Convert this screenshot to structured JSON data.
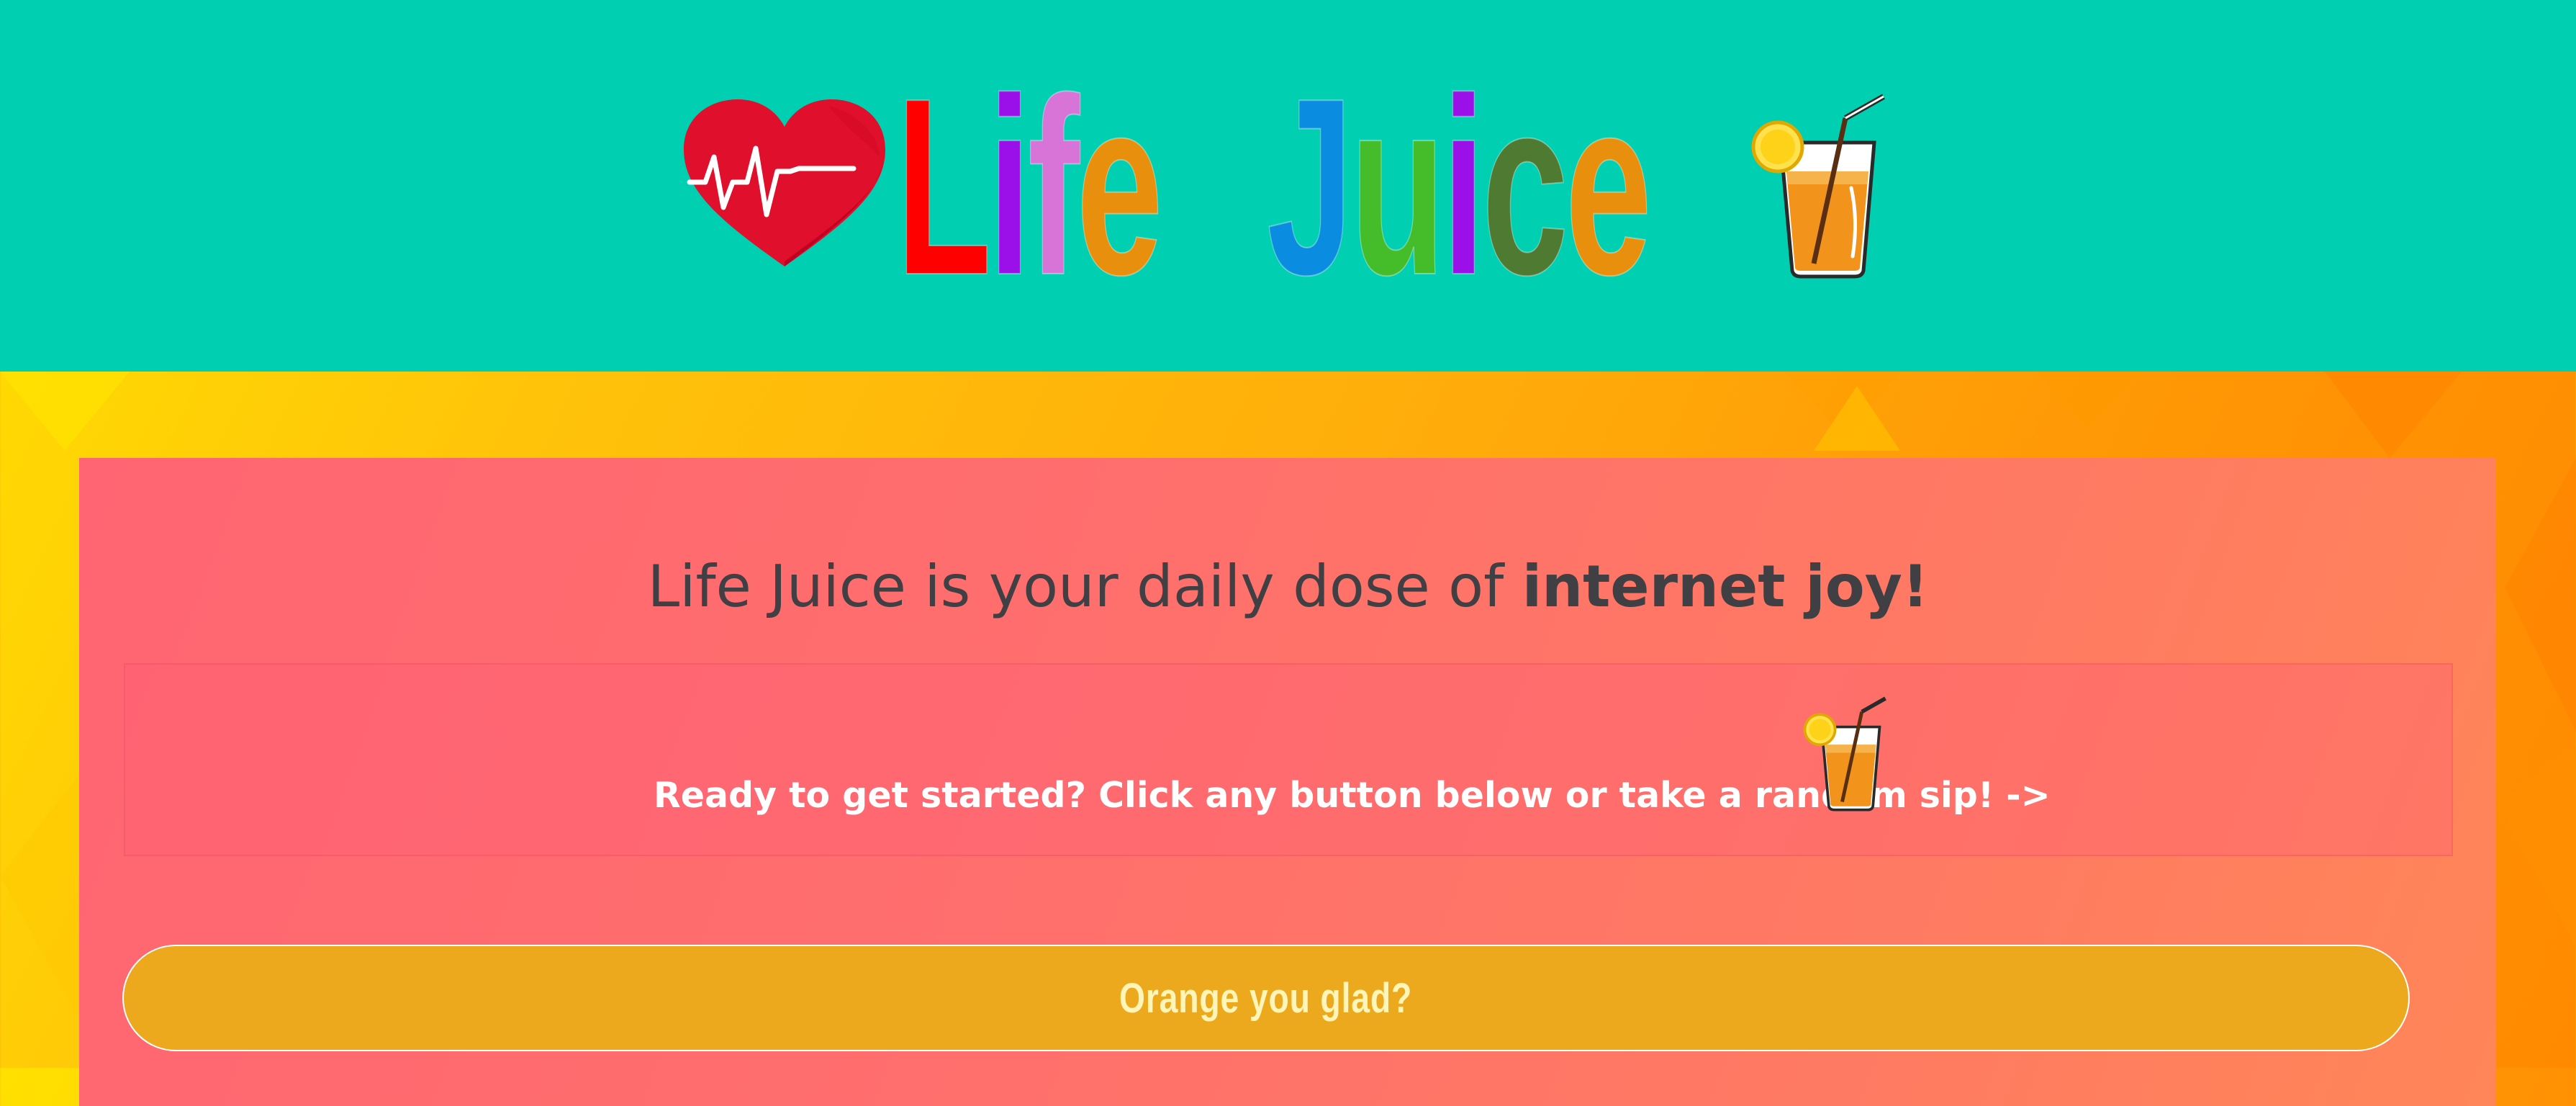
{
  "header": {
    "logo_first_word": [
      "L",
      "i",
      "f",
      "e"
    ],
    "logo_second_word": [
      "J",
      "u",
      "i",
      "c",
      "e"
    ],
    "logo_first_colors": [
      "#ff0000",
      "#9b10e8",
      "#d873d8",
      "#e8900d"
    ],
    "logo_second_colors": [
      "#0a8de0",
      "#45bd2a",
      "#9b10e8",
      "#4f7a31",
      "#e8900d"
    ],
    "background": "#00cfb2",
    "icons": [
      "heartbeat-heart-icon",
      "juice-glass-icon"
    ]
  },
  "main": {
    "tagline_plain": "Life Juice is your daily dose of ",
    "tagline_bold": "internet joy!",
    "cta_text": "Ready to get started? Click any button below or take a random sip! ->",
    "random_sip_icon": "juice-glass-icon",
    "buttons": [
      {
        "label": "Orange you glad?",
        "color": "#eca91e"
      }
    ]
  }
}
